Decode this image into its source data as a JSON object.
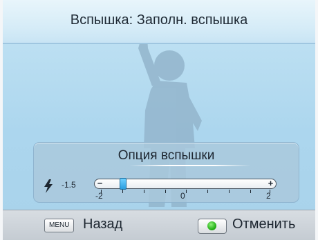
{
  "header": {
    "title": "Вспышка: Заполн. вспышка"
  },
  "panel": {
    "title": "Опция вспышки",
    "flash_icon": "flash-bolt-icon",
    "current_value": "-1.5",
    "slider": {
      "min_label": "-2",
      "mid_label": "0",
      "max_label": "2",
      "minus_label": "−",
      "plus_label": "+",
      "min": -2,
      "max": 2,
      "value": -1.5
    }
  },
  "footer": {
    "menu_key_label": "MENU",
    "back_label": "Назад",
    "ok_key_icon": "green-dot-icon",
    "cancel_label": "Отменить"
  },
  "colors": {
    "accent": "#2a9ee0",
    "ok_green": "#27b31a"
  }
}
